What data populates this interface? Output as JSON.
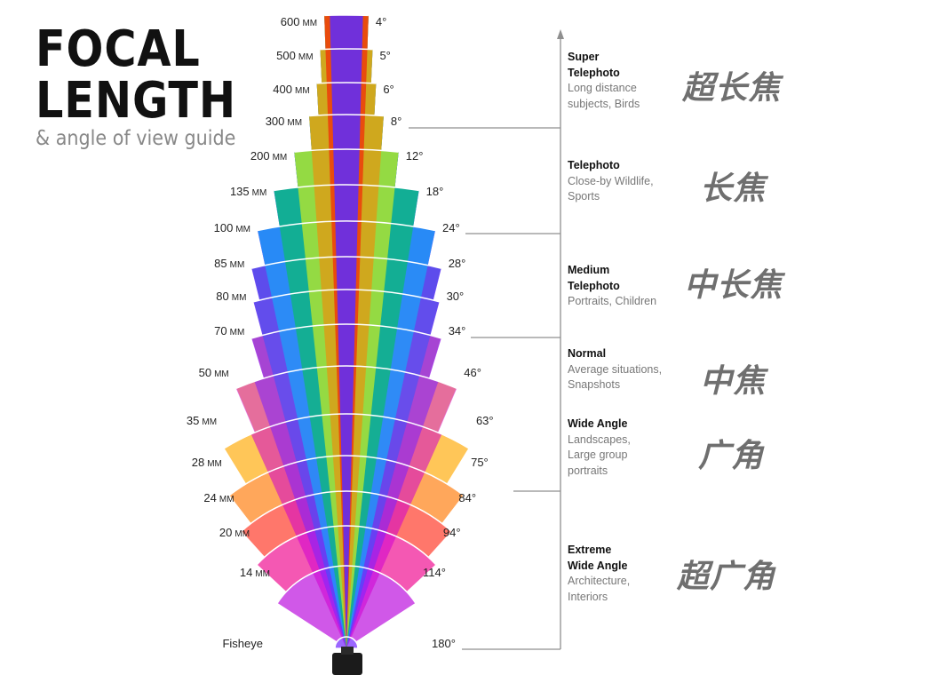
{
  "title": {
    "line1": "FOCAL",
    "line2": "LENGTH",
    "subtitle": "& angle of view guide"
  },
  "chart_data": {
    "type": "diagram",
    "lenses": [
      {
        "focal": "600",
        "unit": "MM",
        "angle": "4°"
      },
      {
        "focal": "500",
        "unit": "MM",
        "angle": "5°"
      },
      {
        "focal": "400",
        "unit": "MM",
        "angle": "6°"
      },
      {
        "focal": "300",
        "unit": "MM",
        "angle": "8°"
      },
      {
        "focal": "200",
        "unit": "MM",
        "angle": "12°"
      },
      {
        "focal": "135",
        "unit": "MM",
        "angle": "18°"
      },
      {
        "focal": "100",
        "unit": "MM",
        "angle": "24°"
      },
      {
        "focal": "85",
        "unit": "MM",
        "angle": "28°"
      },
      {
        "focal": "80",
        "unit": "MM",
        "angle": "30°"
      },
      {
        "focal": "70",
        "unit": "MM",
        "angle": "34°"
      },
      {
        "focal": "50",
        "unit": "MM",
        "angle": "46°"
      },
      {
        "focal": "35",
        "unit": "MM",
        "angle": "63°"
      },
      {
        "focal": "28",
        "unit": "MM",
        "angle": "75°"
      },
      {
        "focal": "24",
        "unit": "MM",
        "angle": "84°"
      },
      {
        "focal": "20",
        "unit": "MM",
        "angle": "94°"
      },
      {
        "focal": "14",
        "unit": "MM",
        "angle": "114°"
      },
      {
        "focal": "Fisheye",
        "unit": "",
        "angle": "180°"
      }
    ]
  },
  "categories": [
    {
      "title_lines": [
        "Super",
        "Telephoto"
      ],
      "desc_lines": [
        "Long distance",
        "subjects, Birds"
      ],
      "chinese": "超长焦"
    },
    {
      "title_lines": [
        "Telephoto"
      ],
      "desc_lines": [
        "Close-by Wildlife,",
        "Sports"
      ],
      "chinese": "长焦"
    },
    {
      "title_lines": [
        "Medium",
        "Telephoto"
      ],
      "desc_lines": [
        "Portraits, Children"
      ],
      "chinese": "中长焦"
    },
    {
      "title_lines": [
        "Normal"
      ],
      "desc_lines": [
        "Average situations,",
        "Snapshots"
      ],
      "chinese": "中焦"
    },
    {
      "title_lines": [
        "Wide Angle"
      ],
      "desc_lines": [
        "Landscapes,",
        "Large group",
        "portraits"
      ],
      "chinese": "广角"
    },
    {
      "title_lines": [
        "Extreme",
        "Wide Angle"
      ],
      "desc_lines": [
        "Architecture,",
        "Interiors"
      ],
      "chinese": "超广角"
    }
  ],
  "colors": {
    "divider_line": "#8f8f8f",
    "rainbow_core": [
      "#ff0000",
      "#ff8000",
      "#ffff00",
      "#00cc44",
      "#00c0ff",
      "#3355ff",
      "#7a22ff",
      "#d000d0"
    ],
    "band_colors": [
      "#6f7cff",
      "#5f7bff",
      "#6aa0ff",
      "#4cc2ff",
      "#36d3c8",
      "#2fd17a",
      "#30d040",
      "#54e039",
      "#9ae532",
      "#e3ef2d",
      "#fff027",
      "#ffb320",
      "#ff8a24",
      "#ff4a3a",
      "#f0209a",
      "#c020e0",
      "#7a33ff"
    ]
  }
}
